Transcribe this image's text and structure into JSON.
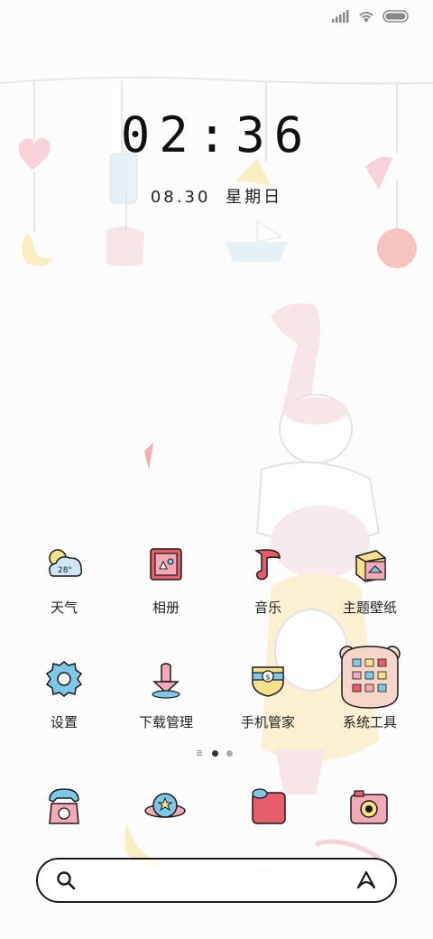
{
  "status_bar": {
    "icons": [
      "signal-icon",
      "wifi-icon",
      "battery-icon"
    ]
  },
  "lock": {
    "time": "02:36",
    "date": "08.30",
    "weekday": "星期日"
  },
  "apps_row1": [
    {
      "name": "weather",
      "label": "天气",
      "icon": "weather-icon",
      "temp": "28°"
    },
    {
      "name": "gallery",
      "label": "相册",
      "icon": "gallery-icon"
    },
    {
      "name": "music",
      "label": "音乐",
      "icon": "music-icon"
    },
    {
      "name": "themes",
      "label": "主题壁纸",
      "icon": "themes-icon"
    }
  ],
  "apps_row2": [
    {
      "name": "settings",
      "label": "设置",
      "icon": "settings-icon"
    },
    {
      "name": "downloads",
      "label": "下载管理",
      "icon": "download-icon"
    },
    {
      "name": "security",
      "label": "手机管家",
      "icon": "security-icon"
    },
    {
      "name": "tools-folder",
      "label": "系统工具",
      "icon": "folder-icon"
    }
  ],
  "page_indicator": {
    "pages": 3,
    "current": 2
  },
  "dock": [
    "phone-icon",
    "browser-icon",
    "messages-icon",
    "camera-icon"
  ],
  "search": {
    "icons": [
      "search-icon",
      "assistant-icon"
    ]
  },
  "colors": {
    "pink": "#f4a9b8",
    "blue": "#7cc8e8",
    "yellow": "#f7e08a",
    "red": "#e85d6a",
    "ink": "#1a1a1a"
  }
}
